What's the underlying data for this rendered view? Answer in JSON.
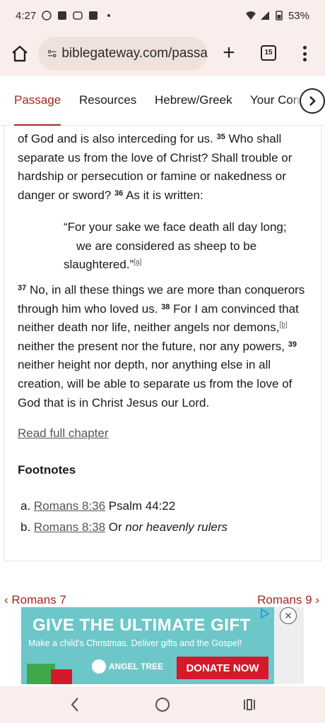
{
  "status_bar": {
    "time": "4:27",
    "battery": "53%"
  },
  "browser": {
    "url": "biblegateway.com/passa",
    "tab_count": "15"
  },
  "tabs": [
    {
      "label": "Passage"
    },
    {
      "label": "Resources"
    },
    {
      "label": "Hebrew/Greek"
    },
    {
      "label": "Your Cont"
    }
  ],
  "passage": {
    "p1_start": "of God and is also interceding for us.",
    "v35": "35",
    "p1_v35": "Who shall separate us from the love of Christ? Shall trouble or hardship or persecution or famine or nakedness or danger or sword?",
    "v36": "36",
    "p1_v36": "As it is written:",
    "poem_line1": "“For your sake we face death all day long;",
    "poem_line2": "we are considered as sheep to be",
    "poem_line3": "slaughtered.”",
    "fn_a": "[a]",
    "v37": "37",
    "p2_v37": "No, in all these things we are more than conquerors through him who loved us.",
    "v38": "38",
    "p2_v38a": "For I am convinced that neither death nor life, neither angels nor demons,",
    "fn_b": "[b]",
    "p2_v38b": "neither the present nor the future, nor any powers,",
    "v39": "39",
    "p2_v39": "neither height nor depth, nor anything else in all creation, will be able to separate us from the love of God that is in Christ Jesus our Lord."
  },
  "read_full_chapter": "Read full chapter",
  "footnotes": {
    "heading": "Footnotes",
    "items": [
      {
        "letter": "a.",
        "ref": "Romans 8:36",
        "text": "Psalm 44:22"
      },
      {
        "letter": "b.",
        "ref": "Romans 8:38",
        "text_plain": "Or",
        "text_italic": "nor heavenly rulers"
      }
    ]
  },
  "chapter_nav": {
    "prev": "Romans 7",
    "next": "Romans 9"
  },
  "ad": {
    "title": "GIVE THE ULTIMATE GIFT",
    "subtitle": "Make a child's Christmas. Deliver gifts and the Gospel!",
    "logo": "ANGEL TREE",
    "cta": "DONATE NOW"
  },
  "colors": {
    "accent": "#a5281b",
    "chrome_bg": "#f9eeeb",
    "ad_bg": "#6dc7c9",
    "ad_cta": "#d6182b"
  }
}
